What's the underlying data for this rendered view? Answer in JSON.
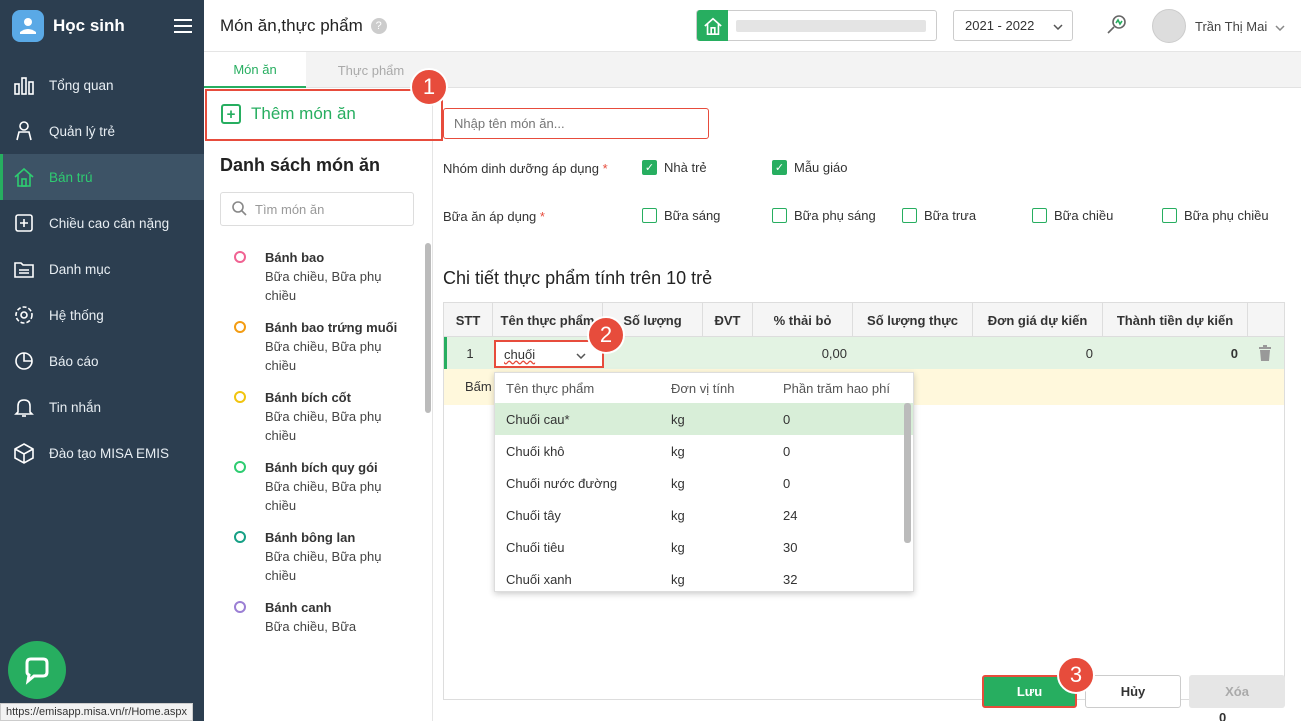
{
  "sidebar": {
    "app_name": "Học sinh",
    "items": [
      {
        "label": "Tổng quan",
        "icon": "chart-icon"
      },
      {
        "label": "Quản lý trẻ",
        "icon": "child-icon"
      },
      {
        "label": "Bán trú",
        "icon": "home-icon",
        "active": true
      },
      {
        "label": "Chiều cao cân nặng",
        "icon": "plus-box-icon"
      },
      {
        "label": "Danh mục",
        "icon": "folder-icon"
      },
      {
        "label": "Hệ thống",
        "icon": "gear-icon"
      },
      {
        "label": "Báo cáo",
        "icon": "pie-icon"
      },
      {
        "label": "Tin nhắn",
        "icon": "bell-icon"
      },
      {
        "label": "Đào tạo MISA EMIS",
        "icon": "cube-icon"
      }
    ],
    "status_url": "https://emisapp.misa.vn/r/Home.aspx"
  },
  "header": {
    "title": "Món ăn,thực phẩm",
    "help": "?",
    "school_year": "2021 - 2022",
    "user_name": "Trần Thị Mai"
  },
  "tabs": [
    {
      "label": "Món ăn",
      "active": true
    },
    {
      "label": "Thực phẩm",
      "active": false
    }
  ],
  "left_panel": {
    "add_label": "Thêm món ăn",
    "list_title": "Danh sách món ăn",
    "search_placeholder": "Tìm món ăn",
    "dishes": [
      {
        "name": "Bánh bao",
        "meals": "Bữa chiều, Bữa phụ chiều",
        "color": "#f06292"
      },
      {
        "name": "Bánh bao trứng muối",
        "meals": "Bữa chiều, Bữa phụ chiều",
        "color": "#f39c12"
      },
      {
        "name": "Bánh bích cốt",
        "meals": "Bữa chiều, Bữa phụ chiều",
        "color": "#f1c40f"
      },
      {
        "name": "Bánh bích quy gói",
        "meals": "Bữa chiều, Bữa phụ chiều",
        "color": "#2ecc71"
      },
      {
        "name": "Bánh bông lan",
        "meals": "Bữa chiều, Bữa phụ chiều",
        "color": "#16a085"
      },
      {
        "name": "Bánh canh",
        "meals": "Bữa chiều, Bữa",
        "color": "#9b7fd4"
      }
    ]
  },
  "form": {
    "name_placeholder": "Nhập tên món ăn...",
    "nutrition_label": "Nhóm dinh dưỡng áp dụng",
    "required_mark": "*",
    "nutrition_options": [
      {
        "label": "Nhà trẻ",
        "checked": true
      },
      {
        "label": "Mẫu giáo",
        "checked": true
      }
    ],
    "meal_label": "Bữa ăn áp dụng",
    "meal_options": [
      {
        "label": "Bữa sáng",
        "checked": false
      },
      {
        "label": "Bữa phụ sáng",
        "checked": false
      },
      {
        "label": "Bữa trưa",
        "checked": false
      },
      {
        "label": "Bữa chiều",
        "checked": false
      },
      {
        "label": "Bữa phụ chiều",
        "checked": false
      }
    ],
    "detail_title": "Chi tiết thực phẩm tính trên 10 trẻ"
  },
  "table": {
    "headers": [
      "STT",
      "Tên thực phẩm",
      "Số lượng",
      "ĐVT",
      "% thải bỏ",
      "Số lượng thực",
      "Đơn giá dự kiến",
      "Thành tiền dự kiến"
    ],
    "row": {
      "stt": "1",
      "food": "chuối",
      "waste": "0,00",
      "price": "0",
      "total": "0"
    },
    "hint_row": "Bấm",
    "footer_total": "0"
  },
  "dropdown": {
    "headers": [
      "Tên thực phẩm",
      "Đơn vị tính",
      "Phần trăm hao phí"
    ],
    "rows": [
      {
        "name": "Chuối cau*",
        "unit": "kg",
        "waste": "0",
        "selected": true
      },
      {
        "name": "Chuối khô",
        "unit": "kg",
        "waste": "0",
        "selected": false
      },
      {
        "name": "Chuối nước đường",
        "unit": "kg",
        "waste": "0",
        "selected": false
      },
      {
        "name": "Chuối tây",
        "unit": "kg",
        "waste": "24",
        "selected": false
      },
      {
        "name": "Chuối tiêu",
        "unit": "kg",
        "waste": "30",
        "selected": false
      },
      {
        "name": "Chuối xanh",
        "unit": "kg",
        "waste": "32",
        "selected": false
      }
    ]
  },
  "buttons": {
    "save": "Lưu",
    "cancel": "Hủy",
    "delete": "Xóa"
  },
  "steps": [
    "1",
    "2",
    "3"
  ],
  "colors": {
    "accent": "#27ae60",
    "sidebar": "#2c3e50",
    "highlight": "#e74c3c"
  }
}
